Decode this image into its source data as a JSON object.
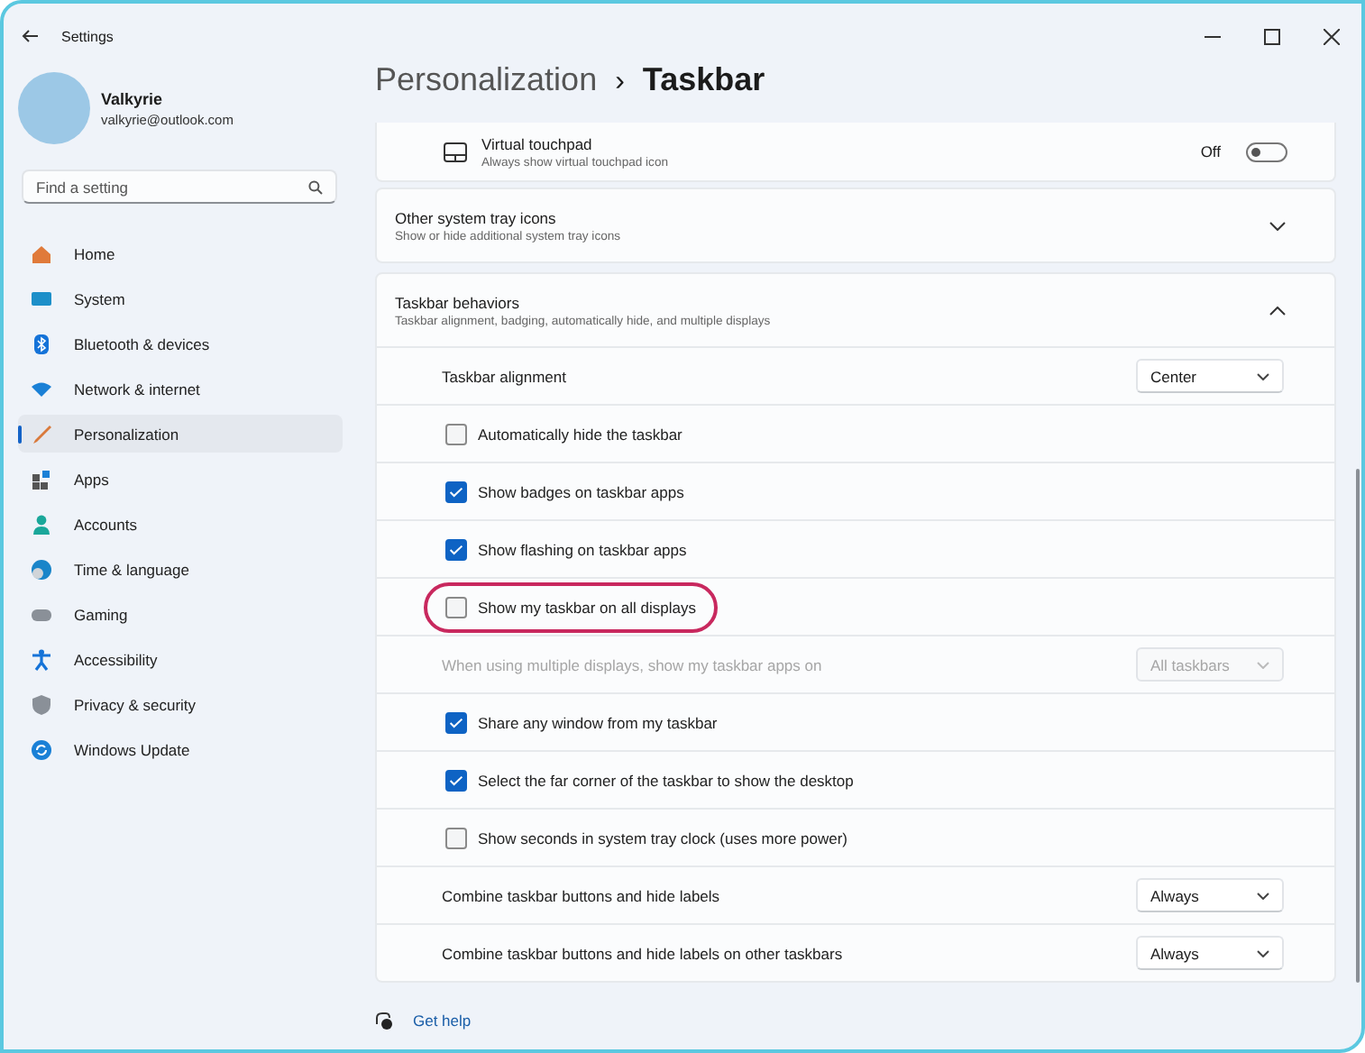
{
  "window": {
    "title": "Settings"
  },
  "profile": {
    "name": "Valkyrie",
    "email": "valkyrie@outlook.com"
  },
  "search": {
    "placeholder": "Find a setting"
  },
  "sidebar": {
    "items": [
      {
        "label": "Home",
        "selected": false
      },
      {
        "label": "System",
        "selected": false
      },
      {
        "label": "Bluetooth & devices",
        "selected": false
      },
      {
        "label": "Network & internet",
        "selected": false
      },
      {
        "label": "Personalization",
        "selected": true
      },
      {
        "label": "Apps",
        "selected": false
      },
      {
        "label": "Accounts",
        "selected": false
      },
      {
        "label": "Time & language",
        "selected": false
      },
      {
        "label": "Gaming",
        "selected": false
      },
      {
        "label": "Accessibility",
        "selected": false
      },
      {
        "label": "Privacy & security",
        "selected": false
      },
      {
        "label": "Windows Update",
        "selected": false
      }
    ]
  },
  "breadcrumb": {
    "parent": "Personalization",
    "separator": "›",
    "current": "Taskbar"
  },
  "virtual_touchpad": {
    "title": "Virtual touchpad",
    "subtitle": "Always show virtual touchpad icon",
    "state_label": "Off",
    "on": false
  },
  "sections": [
    {
      "title": "Other system tray icons",
      "subtitle": "Show or hide additional system tray icons",
      "expanded": false
    },
    {
      "title": "Taskbar behaviors",
      "subtitle": "Taskbar alignment, badging, automatically hide, and multiple displays",
      "expanded": true
    }
  ],
  "rows": [
    {
      "kind": "dropdown",
      "label": "Taskbar alignment",
      "value": "Center",
      "disabled": false
    },
    {
      "kind": "checkbox",
      "label": "Automatically hide the taskbar",
      "checked": false,
      "highlighted": false
    },
    {
      "kind": "checkbox",
      "label": "Show badges on taskbar apps",
      "checked": true,
      "highlighted": false
    },
    {
      "kind": "checkbox",
      "label": "Show flashing on taskbar apps",
      "checked": true,
      "highlighted": false
    },
    {
      "kind": "checkbox",
      "label": "Show my taskbar on all displays",
      "checked": false,
      "highlighted": true
    },
    {
      "kind": "dropdown",
      "label": "When using multiple displays, show my taskbar apps on",
      "value": "All taskbars",
      "disabled": true
    },
    {
      "kind": "checkbox",
      "label": "Share any window from my taskbar",
      "checked": true,
      "highlighted": false
    },
    {
      "kind": "checkbox",
      "label": "Select the far corner of the taskbar to show the desktop",
      "checked": true,
      "highlighted": false
    },
    {
      "kind": "checkbox",
      "label": "Show seconds in system tray clock (uses more power)",
      "checked": false,
      "highlighted": false
    },
    {
      "kind": "dropdown",
      "label": "Combine taskbar buttons and hide labels",
      "value": "Always",
      "disabled": false
    },
    {
      "kind": "dropdown",
      "label": "Combine taskbar buttons and hide labels on other taskbars",
      "value": "Always",
      "disabled": false
    }
  ],
  "footer": {
    "link": "Get help"
  }
}
